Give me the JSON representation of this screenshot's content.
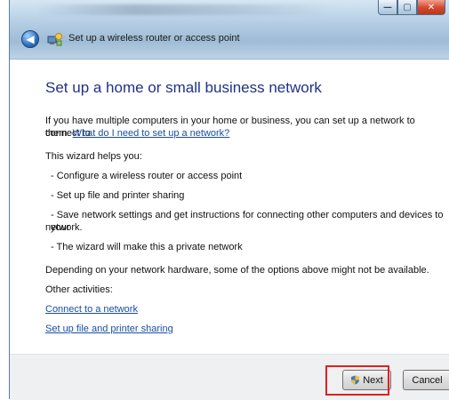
{
  "window": {
    "title": "Set up a wireless router or access point",
    "controls": {
      "minimize": "—",
      "maximize": "▢",
      "close": "✕"
    }
  },
  "content": {
    "heading": "Set up a home or small business network",
    "intro_line1": "If you have multiple computers in your home or business, you can set up a network to connect to",
    "intro_line2_prefix": "them.",
    "intro_link": "What do I need to set up a network?",
    "wizard_helps": "This wizard helps you:",
    "bullets": [
      "- Configure a wireless router or access point",
      "- Set up file and printer sharing",
      "- Save network settings and get instructions for connecting other computers and devices to your",
      "network.",
      "- The wizard will make this a private network"
    ],
    "depending": "Depending on your network hardware, some of the options above might not be available.",
    "other_activities": "Other activities:",
    "links": [
      "Connect to a network",
      "Set up file and printer sharing"
    ]
  },
  "buttons": {
    "next": "Next",
    "cancel": "Cancel"
  },
  "icons": {
    "back": "back-arrow-icon",
    "wizard": "network-wizard-icon",
    "next_shield": "uac-shield-icon"
  },
  "colors": {
    "heading": "#1e3287",
    "link": "#1a4ea1",
    "highlight": "#e02020"
  }
}
